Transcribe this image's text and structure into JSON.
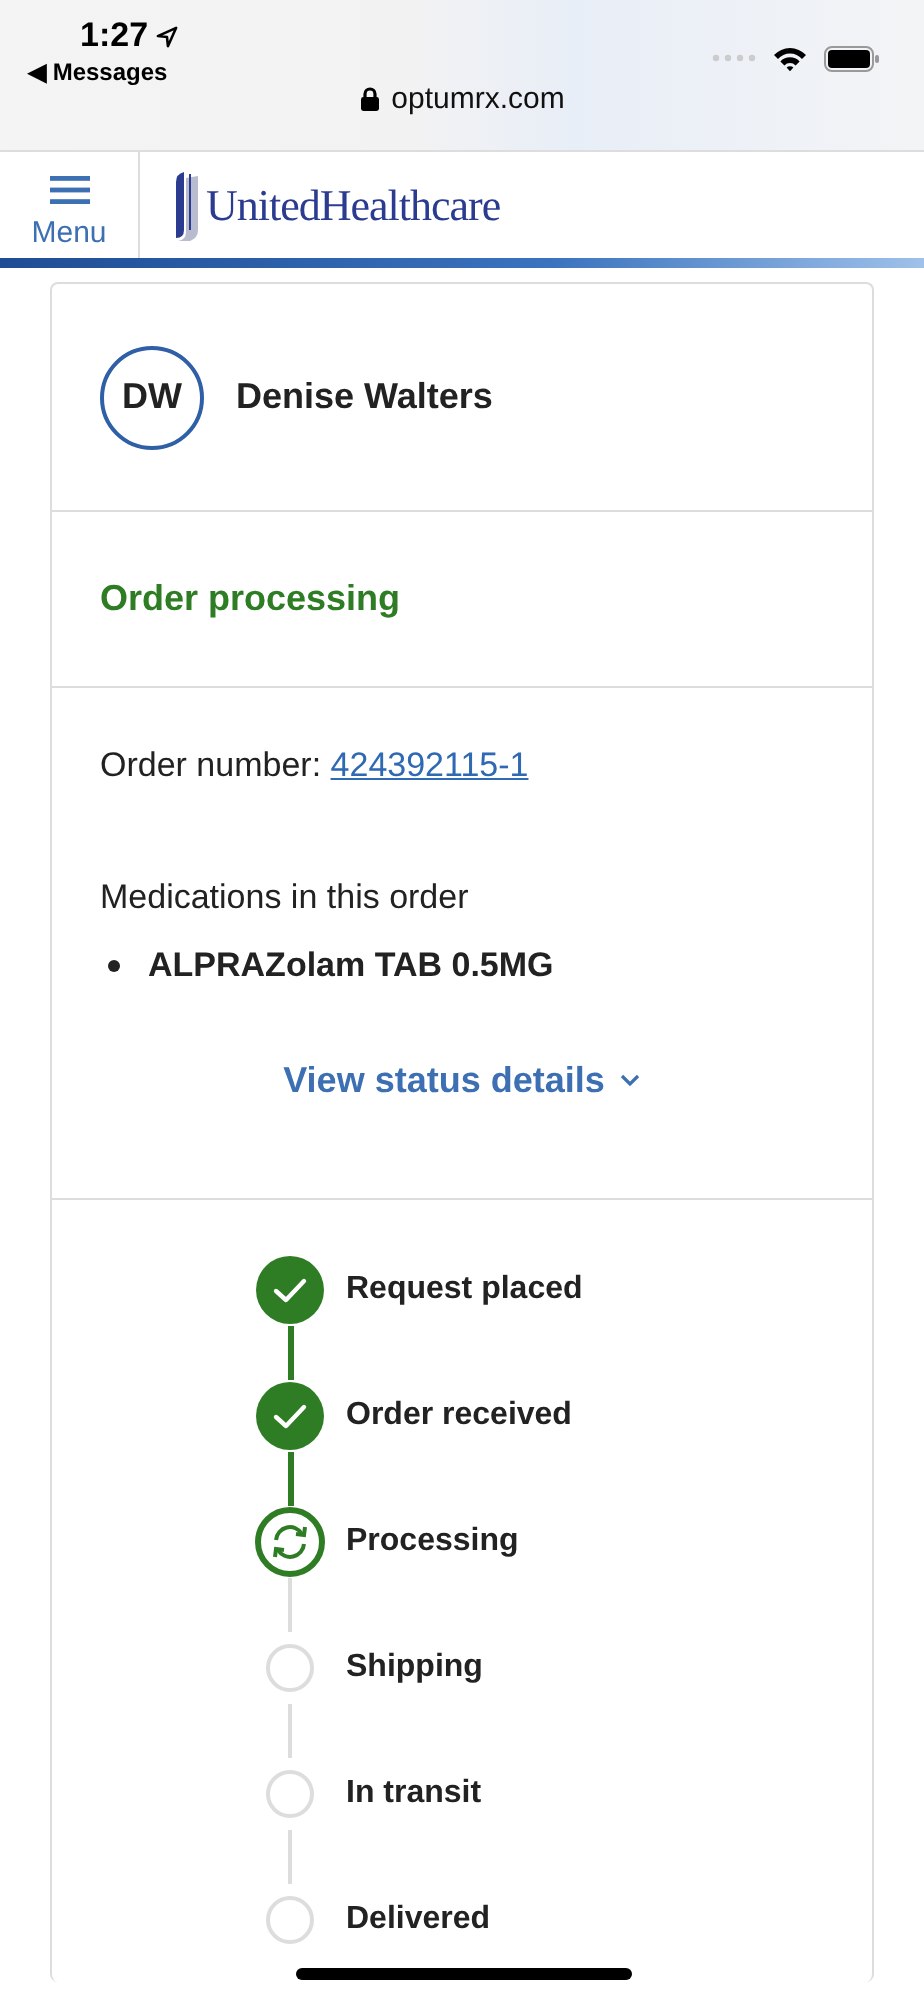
{
  "status_bar": {
    "time": "1:27",
    "back_label": "◀ Messages",
    "url": "optumrx.com"
  },
  "header": {
    "menu_label": "Menu",
    "logo_text": "UnitedHealthcare"
  },
  "profile": {
    "initials": "DW",
    "name": "Denise Walters"
  },
  "order_status": "Order processing",
  "order": {
    "number_label": "Order number:",
    "number": "424392115-1",
    "medications_heading": "Medications in this order",
    "medications": [
      "ALPRAZolam TAB 0.5MG"
    ],
    "details_link": "View status details"
  },
  "steps": [
    {
      "label": "Request placed",
      "completed": true,
      "current": false
    },
    {
      "label": "Order received",
      "completed": true,
      "current": false
    },
    {
      "label": "Processing",
      "completed": false,
      "current": true
    },
    {
      "label": "Shipping",
      "completed": false,
      "current": false
    },
    {
      "label": "In transit",
      "completed": false,
      "current": false
    },
    {
      "label": "Delivered",
      "completed": false,
      "current": false
    }
  ]
}
